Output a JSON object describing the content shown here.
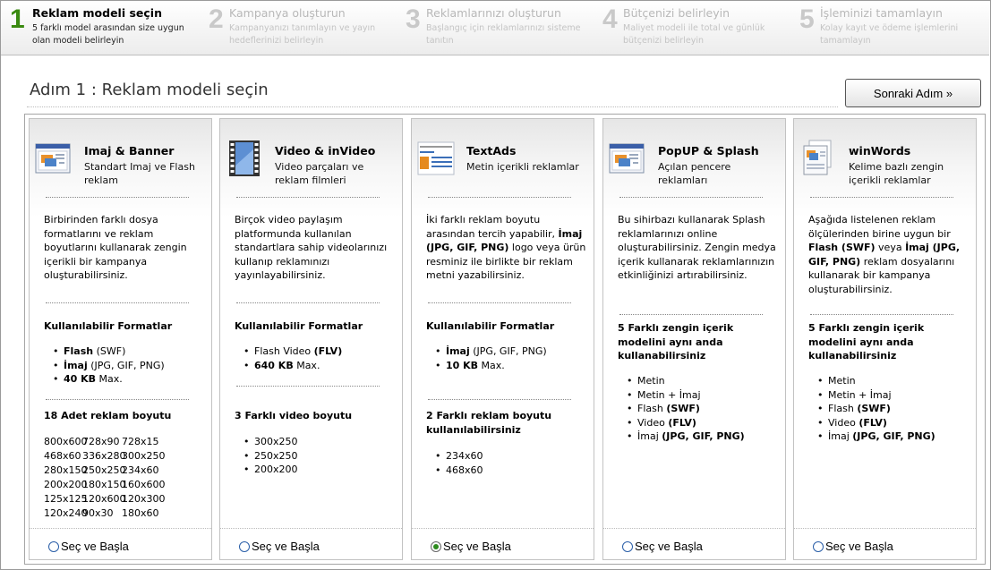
{
  "steps": [
    {
      "num": "1",
      "title": "Reklam modeli seçin",
      "desc": "5 farklı model arasından size uygun olan modeli belirleyin",
      "active": true
    },
    {
      "num": "2",
      "title": "Kampanya oluşturun",
      "desc": "Kampanyanızı tanımlayın ve yayın hedeflerinizi belirleyin",
      "active": false
    },
    {
      "num": "3",
      "title": "Reklamlarınızı oluşturun",
      "desc": "Başlangıç için reklamlarınızı sisteme tanıtın",
      "active": false
    },
    {
      "num": "4",
      "title": "Bütçenizi belirleyin",
      "desc": "Maliyet modeli ile total ve günlük bütçenizi belirleyin",
      "active": false
    },
    {
      "num": "5",
      "title": "İşleminizi tamamlayın",
      "desc": "Kolay kayıt ve ödeme işlemlerini tamamlayın",
      "active": false
    }
  ],
  "header": {
    "title": "Adım 1 : Reklam modeli seçin",
    "next_button": "Sonraki Adım »"
  },
  "select_label": "Seç ve Başla",
  "cards": [
    {
      "icon": "banner-window-icon",
      "title": "Imaj & Banner",
      "subtitle": "Standart Imaj ve Flash reklam",
      "description": "Birbirinden farklı dosya formatlarını ve reklam boyutlarını kullanarak zengin içerikli bir kampanya oluşturabilirsiniz.",
      "section1_title": "Kullanılabilir Formatlar",
      "section1_items": [
        [
          "Flash",
          " (SWF)"
        ],
        [
          "İmaj",
          " (JPG, GIF, PNG)"
        ],
        [
          "40 KB",
          " Max."
        ]
      ],
      "section2_title": "18 Adet reklam boyutu",
      "section2_items": [
        "800x600",
        "728x90",
        "728x15",
        "468x60",
        "336x280",
        "300x250",
        "280x150",
        "250x250",
        "234x60",
        "200x200",
        "180x150",
        "160x600",
        "125x125",
        "120x600",
        "120x300",
        "120x240",
        "90x30",
        "180x60"
      ],
      "selected": false
    },
    {
      "icon": "video-film-icon",
      "title": "Video & inVideo",
      "subtitle": "Video parçaları ve reklam filmleri",
      "description": "Birçok video paylaşım platformunda kullanılan standartlara sahip videolarınızı kullanıp reklamınızı yayınlayabilirsiniz.",
      "section1_title": "Kullanılabilir Formatlar",
      "section1_items": [
        [
          "",
          "Flash Video ",
          "(FLV)"
        ],
        [
          "640 KB",
          " Max.",
          ""
        ]
      ],
      "section2_title": "3 Farklı video boyutu",
      "section2_items": [
        "300x250",
        "250x250",
        "200x200"
      ],
      "selected": false
    },
    {
      "icon": "text-ad-icon",
      "title": "TextAds",
      "subtitle": "Metin içerikli reklamlar",
      "description_parts": [
        "İki farklı reklam boyutu arasından tercih yapabilir, ",
        "İmaj (JPG, GIF, PNG)",
        " logo veya ürün resminiz ile birlikte bir reklam metni yazabilirsiniz."
      ],
      "section1_title": "Kullanılabilir Formatlar",
      "section1_items": [
        [
          "İmaj",
          " (JPG, GIF, PNG)"
        ],
        [
          "10 KB",
          " Max."
        ]
      ],
      "section2_title": "2 Farklı reklam boyutu kullanılabilirsiniz",
      "section2_items": [
        "234x60",
        "468x60"
      ],
      "selected": true
    },
    {
      "icon": "popup-window-icon",
      "title": "PopUP & Splash",
      "subtitle": "Açılan pencere reklamları",
      "description": "Bu sihirbazı kullanarak Splash reklamlarınızı online oluşturabilirsiniz. Zengin medya içerik kullanarak reklamlarınızın etkinliğinizi artırabilirsiniz.",
      "section1_title": "5 Farklı zengin içerik modelini aynı anda kullanabilirsiniz",
      "section1_items": [
        [
          "",
          "Metin",
          ""
        ],
        [
          "",
          "Metin + İmaj",
          ""
        ],
        [
          "",
          "Flash ",
          "(SWF)"
        ],
        [
          "",
          "Video ",
          "(FLV)"
        ],
        [
          "",
          "İmaj ",
          "(JPG, GIF, PNG)"
        ]
      ],
      "selected": false
    },
    {
      "icon": "document-icon",
      "title": "winWords",
      "subtitle": "Kelime bazlı zengin içerikli reklamlar",
      "description_parts": [
        "Aşağıda listelenen reklam ölçülerinden birine uygun bir ",
        "Flash (SWF)",
        " veya ",
        "İmaj (JPG, GIF, PNG)",
        " reklam dosyalarını kullanarak bir kampanya oluşturabilirsiniz."
      ],
      "section1_title": "5 Farklı zengin içerik modelini aynı anda kullanabilirsiniz",
      "section1_items": [
        [
          "",
          "Metin",
          ""
        ],
        [
          "",
          "Metin + İmaj",
          ""
        ],
        [
          "",
          "Flash ",
          "(SWF)"
        ],
        [
          "",
          "Video ",
          "(FLV)"
        ],
        [
          "",
          "İmaj ",
          "(JPG, GIF, PNG)"
        ]
      ],
      "selected": false
    }
  ]
}
